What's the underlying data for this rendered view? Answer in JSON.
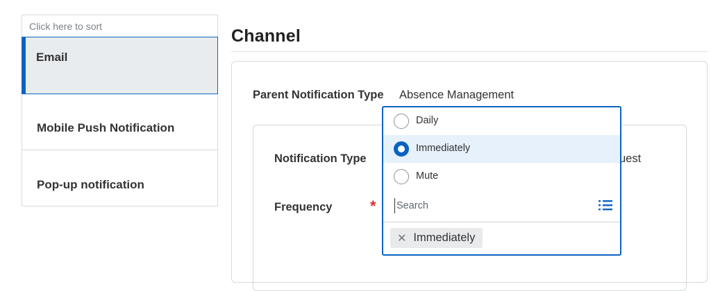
{
  "channel_list": {
    "sort_hint": "Click here to sort",
    "items": [
      {
        "label": "Email",
        "selected": true
      },
      {
        "label": "Mobile Push Notification",
        "selected": false
      },
      {
        "label": "Pop-up notification",
        "selected": false
      }
    ]
  },
  "main": {
    "title": "Channel",
    "parent_notification_type": {
      "label": "Parent Notification Type",
      "value": "Absence Management"
    },
    "notification_type": {
      "label": "Notification Type",
      "value_visible_fragment": "uest"
    },
    "frequency": {
      "label": "Frequency",
      "required_marker": "*",
      "options": [
        {
          "label": "Daily",
          "selected": false
        },
        {
          "label": "Immediately",
          "selected": true
        },
        {
          "label": "Mute",
          "selected": false
        }
      ],
      "search_placeholder": "Search",
      "list_icon": "list-icon",
      "selected_pill": {
        "label": "Immediately",
        "remove_icon": "✕"
      }
    }
  },
  "colors": {
    "accent": "#0b63c1",
    "selected_bg": "#e8ecee",
    "option_hover_bg": "#e6f1fb",
    "required": "#de2d2d"
  }
}
